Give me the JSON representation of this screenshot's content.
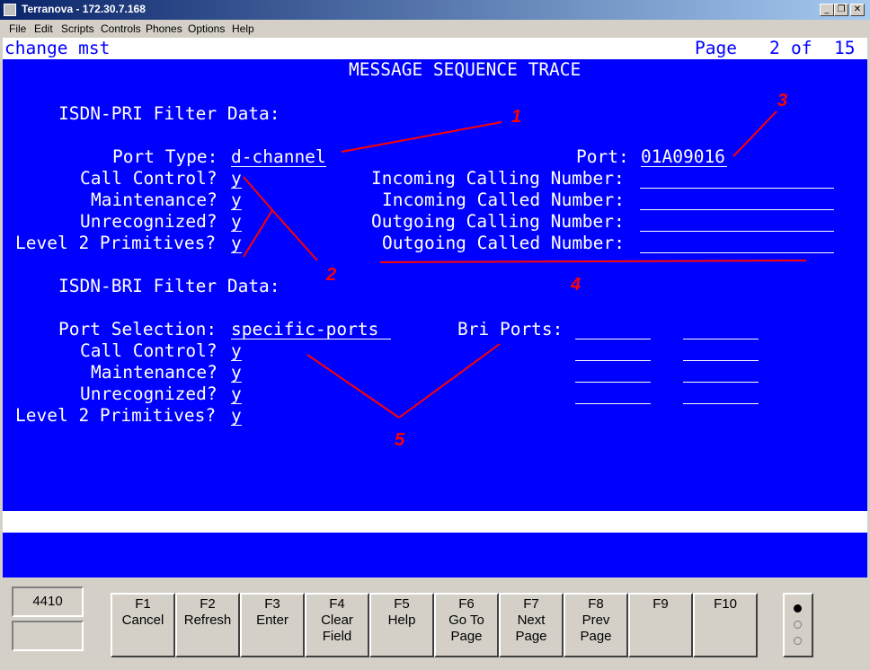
{
  "window": {
    "title": "Terranova - 172.30.7.168",
    "minimize_glyph": "_",
    "restore_glyph": "❐",
    "close_glyph": "✕"
  },
  "menubar": [
    "File",
    "Edit",
    "Scripts",
    "Controls",
    "Phones",
    "Options",
    "Help"
  ],
  "terminal": {
    "command": "change mst",
    "page_label": "Page",
    "page_current": "2",
    "page_of": "of",
    "page_total": "15",
    "form_title": "MESSAGE SEQUENCE TRACE",
    "pri": {
      "heading": "ISDN-PRI Filter Data:",
      "port_type_label": "Port Type:",
      "port_type_value": "d-channel",
      "call_control_label": "Call Control?",
      "call_control_value": "y",
      "maintenance_label": "Maintenance?",
      "maintenance_value": "y",
      "unrecognized_label": "Unrecognized?",
      "unrecognized_value": "y",
      "level2_label": "Level 2 Primitives?",
      "level2_value": "y",
      "port_label": "Port:",
      "port_value": "01A09016",
      "incoming_calling_label": "Incoming Calling Number:",
      "incoming_calling_value": "",
      "incoming_called_label": "Incoming Called Number:",
      "incoming_called_value": "",
      "outgoing_calling_label": "Outgoing Calling Number:",
      "outgoing_calling_value": "",
      "outgoing_called_label": "Outgoing Called Number:",
      "outgoing_called_value": ""
    },
    "bri": {
      "heading": "ISDN-BRI Filter Data:",
      "port_selection_label": "Port Selection:",
      "port_selection_value": "specific-ports",
      "call_control_label": "Call Control?",
      "call_control_value": "y",
      "maintenance_label": "Maintenance?",
      "maintenance_value": "y",
      "unrecognized_label": "Unrecognized?",
      "unrecognized_value": "y",
      "level2_label": "Level 2 Primitives?",
      "level2_value": "y",
      "bri_ports_label": "Bri Ports:",
      "bri_ports": [
        "",
        "",
        "",
        "",
        "",
        "",
        "",
        ""
      ]
    }
  },
  "annotations": {
    "items": [
      "1",
      "2",
      "3",
      "4",
      "5"
    ],
    "color": "#ff0000"
  },
  "bottom": {
    "station": "4410",
    "station2": "",
    "fkeys": [
      {
        "name": "F1",
        "label": "Cancel"
      },
      {
        "name": "F2",
        "label": "Refresh"
      },
      {
        "name": "F3",
        "label": "Enter"
      },
      {
        "name": "F4",
        "label": "Clear\nField"
      },
      {
        "name": "F5",
        "label": "Help"
      },
      {
        "name": "F6",
        "label": "Go To\nPage"
      },
      {
        "name": "F7",
        "label": "Next\nPage"
      },
      {
        "name": "F8",
        "label": "Prev\nPage"
      },
      {
        "name": "F9",
        "label": ""
      },
      {
        "name": "F10",
        "label": ""
      }
    ],
    "radio_selected": 0
  },
  "colors": {
    "screen_bg": "#0000ff",
    "screen_fg": "#ffffff",
    "annotation": "#ff0000"
  }
}
